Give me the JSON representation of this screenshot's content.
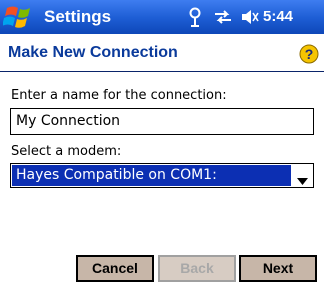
{
  "titlebar": {
    "app_title": "Settings",
    "clock": "5:44",
    "icons": [
      "windows-start-icon",
      "connectivity-icon",
      "sync-icon",
      "volume-icon"
    ]
  },
  "header": {
    "title": "Make New Connection",
    "help_icon": "help-icon"
  },
  "form": {
    "name_label": "Enter a name for the connection:",
    "name_value": "My Connection",
    "modem_label": "Select a modem:",
    "modem_selected": "Hayes Compatible on COM1:"
  },
  "buttons": {
    "cancel": "Cancel",
    "back": "Back",
    "next": "Next"
  },
  "colors": {
    "titlebar": "#1f5fd6",
    "header_text": "#0a3a9b",
    "selection": "#0c2fb3",
    "button": "#c7b6a8"
  }
}
